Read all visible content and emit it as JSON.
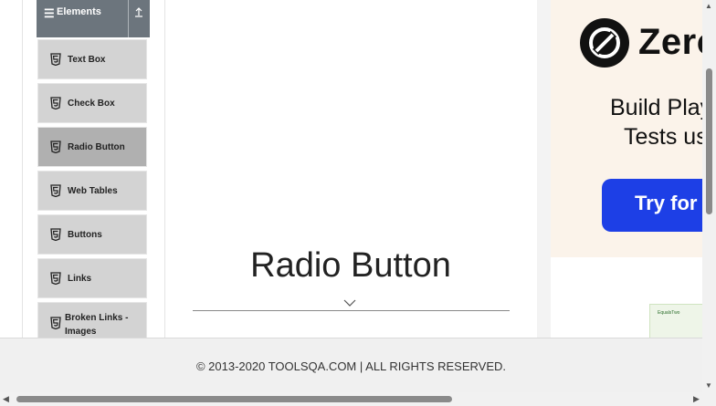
{
  "sidebar": {
    "group_label": "Elements",
    "items": [
      {
        "label": "Text Box",
        "active": false
      },
      {
        "label": "Check Box",
        "active": false
      },
      {
        "label": "Radio Button",
        "active": true
      },
      {
        "label": "Web Tables",
        "active": false
      },
      {
        "label": "Buttons",
        "active": false
      },
      {
        "label": "Links",
        "active": false
      },
      {
        "label": "Broken Links - Images",
        "active": false
      }
    ]
  },
  "main": {
    "title": "Radio Button"
  },
  "ad": {
    "brand": "Zero",
    "line1": "Build Play",
    "line2": "Tests us",
    "cta": "Try for fr",
    "product_label": "EqualsTwo"
  },
  "footer": {
    "copyright": "© 2013-2020 TOOLSQA.COM | ALL RIGHTS RESERVED."
  },
  "colors": {
    "group_header_bg": "#6c757d",
    "item_bg": "#d3d3d3",
    "item_active_bg": "#b0b0b0",
    "ad_cta_bg": "#1d3fe6"
  }
}
